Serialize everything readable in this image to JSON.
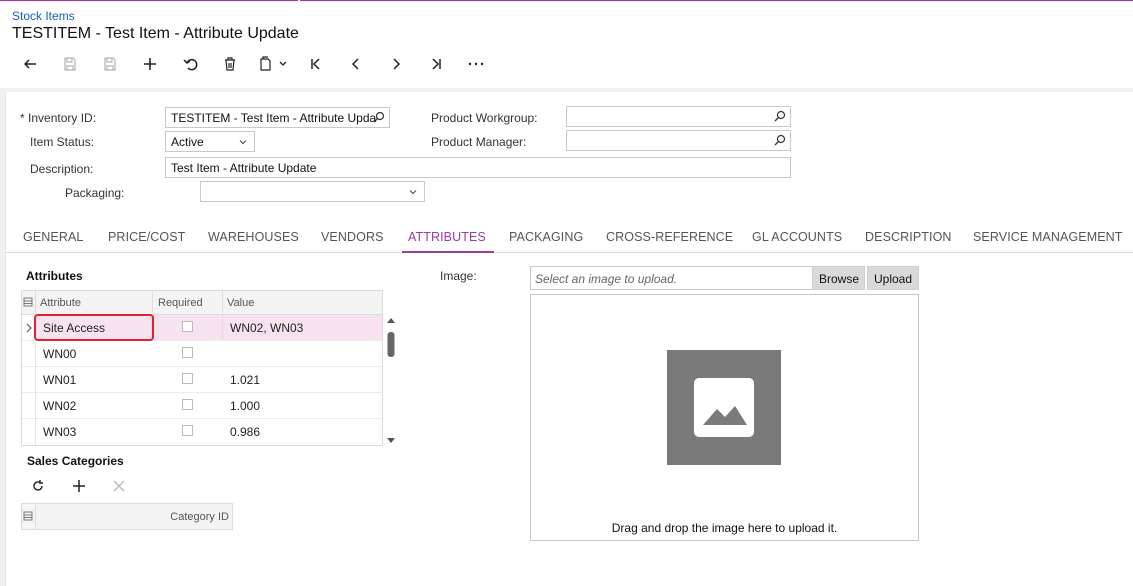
{
  "header": {
    "breadcrumb": "Stock Items",
    "title": "TESTITEM - Test Item - Attribute Update"
  },
  "toolbar": {
    "icons": [
      "back-arrow-icon",
      "save-close-icon",
      "save-icon",
      "add-icon",
      "undo-icon",
      "delete-icon",
      "copy-icon",
      "first-record-icon",
      "previous-record-icon",
      "next-record-icon",
      "last-record-icon",
      "more-icon"
    ]
  },
  "form": {
    "inventory_id_label": "Inventory ID:",
    "inventory_id_required_mark": "*",
    "inventory_id_value": "TESTITEM - Test Item - Attribute Upda",
    "item_status_label": "Item Status:",
    "item_status_value": "Active",
    "description_label": "Description:",
    "description_value": "Test Item - Attribute Update",
    "packaging_label": "Packaging:",
    "packaging_value": "",
    "product_workgroup_label": "Product Workgroup:",
    "product_workgroup_value": "",
    "product_manager_label": "Product Manager:",
    "product_manager_value": ""
  },
  "tabs": [
    {
      "label": "GENERAL"
    },
    {
      "label": "PRICE/COST"
    },
    {
      "label": "WAREHOUSES"
    },
    {
      "label": "VENDORS"
    },
    {
      "label": "ATTRIBUTES"
    },
    {
      "label": "PACKAGING"
    },
    {
      "label": "CROSS-REFERENCE"
    },
    {
      "label": "GL ACCOUNTS"
    },
    {
      "label": "DESCRIPTION"
    },
    {
      "label": "SERVICE MANAGEMENT"
    }
  ],
  "active_tab": "ATTRIBUTES",
  "attributes": {
    "title": "Attributes",
    "columns": [
      "Attribute",
      "Required",
      "Value"
    ],
    "rows": [
      {
        "attribute": "Site Access",
        "required": false,
        "value": "WN02, WN03"
      },
      {
        "attribute": "WN00",
        "required": false,
        "value": ""
      },
      {
        "attribute": "WN01",
        "required": false,
        "value": "1.021"
      },
      {
        "attribute": "WN02",
        "required": false,
        "value": "1.000"
      },
      {
        "attribute": "WN03",
        "required": false,
        "value": "0.986"
      }
    ]
  },
  "sales_categories": {
    "title": "Sales Categories",
    "column": "Category ID"
  },
  "image": {
    "label": "Image:",
    "placeholder": "Select an image to upload.",
    "browse_label": "Browse",
    "upload_label": "Upload",
    "drop_text": "Drag and drop the image here to upload it."
  },
  "colors": {
    "accent": "#9b3c9e",
    "selected_row": "#f7e3f0",
    "highlight": "#e0212f",
    "link": "#1a5fb4"
  }
}
